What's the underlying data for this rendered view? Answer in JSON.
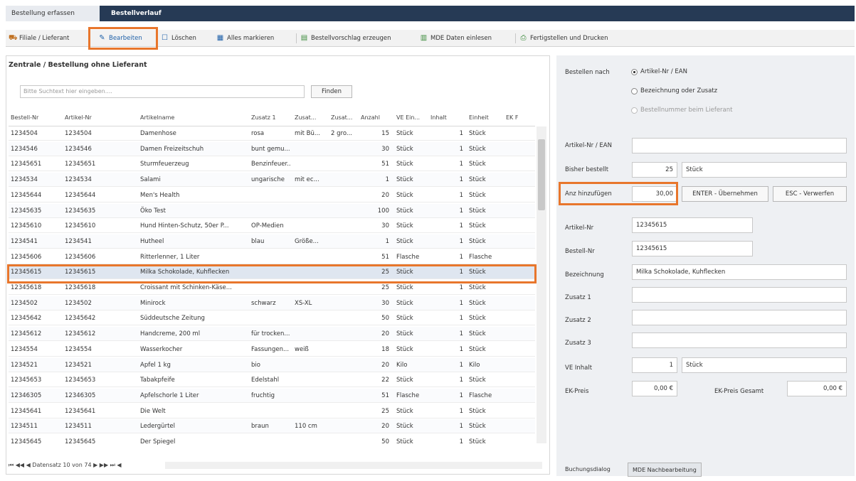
{
  "tabs": [
    "Bestellung erfassen",
    "Bestellverlauf"
  ],
  "toolbar": [
    {
      "label": "Filiale / Lieferant",
      "icon": "truck-icon"
    },
    {
      "label": "Bearbeiten",
      "icon": "edit-icon"
    },
    {
      "label": "Löschen",
      "icon": "delete-icon"
    },
    {
      "label": "Alles markieren",
      "icon": "grid-icon"
    },
    {
      "label": "Bestellvorschlag erzeugen",
      "icon": "proposal-icon"
    },
    {
      "label": "MDE Daten einlesen",
      "icon": "scanner-icon"
    },
    {
      "label": "Fertigstellen und Drucken",
      "icon": "print-icon"
    }
  ],
  "left": {
    "title": "Zentrale / Bestellung ohne Lieferant",
    "search_placeholder": "Bitte Suchtext hier eingeben....",
    "find_label": "Finden"
  },
  "grid": {
    "columns": [
      "Bestell-Nr",
      "Artikel-Nr",
      "Artikelname",
      "Zusatz 1",
      "Zusat...",
      "Zusat...",
      "Anzahl",
      "VE Ein...",
      "Inhalt",
      "Einheit",
      "EK F"
    ],
    "rows": [
      [
        "1234504",
        "1234504",
        "Damenhose",
        "rosa",
        "mit Bü...",
        "2 gro...",
        "15",
        "Stück",
        "1",
        "Stück"
      ],
      [
        "1234546",
        "1234546",
        "Damen Freizeitschuh",
        "bunt gemu...",
        "",
        "",
        "30",
        "Stück",
        "1",
        "Stück"
      ],
      [
        "12345651",
        "12345651",
        "Sturmfeuerzeug",
        "Benzinfeuer...",
        "",
        "",
        "51",
        "Stück",
        "1",
        "Stück"
      ],
      [
        "1234534",
        "1234534",
        "Salami",
        "ungarische",
        "mit ec...",
        "",
        "1",
        "Stück",
        "1",
        "Stück"
      ],
      [
        "12345644",
        "12345644",
        "Men's Health",
        "",
        "",
        "",
        "20",
        "Stück",
        "1",
        "Stück"
      ],
      [
        "12345635",
        "12345635",
        "Öko Test",
        "",
        "",
        "",
        "100",
        "Stück",
        "1",
        "Stück"
      ],
      [
        "12345610",
        "12345610",
        "Hund Hinten-Schutz, 50er P...",
        "OP-Medien",
        "",
        "",
        "30",
        "Stück",
        "1",
        "Stück"
      ],
      [
        "1234541",
        "1234541",
        "Hutheel",
        "blau",
        "Größe...",
        "",
        "1",
        "Stück",
        "1",
        "Stück"
      ],
      [
        "12345606",
        "12345606",
        "Ritterlenner, 1 Liter",
        "",
        "",
        "",
        "51",
        "Flasche",
        "1",
        "Flasche"
      ],
      [
        "12345615",
        "12345615",
        "Milka Schokolade, Kuhflecken",
        "",
        "",
        "",
        "25",
        "Stück",
        "1",
        "Stück"
      ],
      [
        "12345618",
        "12345618",
        "Croissant mit Schinken-Käse...",
        "",
        "",
        "",
        "25",
        "Stück",
        "1",
        "Stück"
      ],
      [
        "1234502",
        "1234502",
        "Minirock",
        "schwarz",
        "XS-XL",
        "",
        "30",
        "Stück",
        "1",
        "Stück"
      ],
      [
        "12345642",
        "12345642",
        "Süddeutsche Zeitung",
        "",
        "",
        "",
        "50",
        "Stück",
        "1",
        "Stück"
      ],
      [
        "12345612",
        "12345612",
        "Handcreme, 200 ml",
        "für trocken...",
        "",
        "",
        "20",
        "Stück",
        "1",
        "Stück"
      ],
      [
        "1234554",
        "1234554",
        "Wasserkocher",
        "Fassungen...",
        "weiß",
        "",
        "18",
        "Stück",
        "1",
        "Stück"
      ],
      [
        "1234521",
        "1234521",
        "Apfel 1 kg",
        "bio",
        "",
        "",
        "20",
        "Kilo",
        "1",
        "Kilo"
      ],
      [
        "12345653",
        "12345653",
        "Tabakpfeife",
        "Edelstahl",
        "",
        "",
        "22",
        "Stück",
        "1",
        "Stück"
      ],
      [
        "12346305",
        "12346305",
        "Apfelschorle 1 Liter",
        "fruchtig",
        "",
        "",
        "51",
        "Flasche",
        "1",
        "Flasche"
      ],
      [
        "12345641",
        "12345641",
        "Die Welt",
        "",
        "",
        "",
        "25",
        "Stück",
        "1",
        "Stück"
      ],
      [
        "1234511",
        "1234511",
        "Ledergürtel",
        "braun",
        "110 cm",
        "",
        "20",
        "Stück",
        "1",
        "Stück"
      ],
      [
        "12345645",
        "12345645",
        "Der Spiegel",
        "",
        "",
        "",
        "50",
        "Stück",
        "1",
        "Stück"
      ]
    ],
    "selected_index": 9,
    "nav_text": "⏮ ◀◀ ◀ Datensatz 10 von 74 ▶ ▶▶ ⏭ ◀"
  },
  "right": {
    "bestellen_nach": "Bestellen nach",
    "radio_options": [
      "Artikel-Nr / EAN",
      "Bezeichnung oder Zusatz",
      "Bestellnummer beim Lieferant"
    ],
    "artikel_ean_label": "Artikel-Nr / EAN",
    "artikel_ean_value": "",
    "bisher_label": "Bisher bestellt",
    "bisher_value": "25",
    "bisher_unit": "Stück",
    "anz_label": "Anz hinzufügen",
    "anz_value": "30,00",
    "enter_btn": "ENTER - Übernehmen",
    "esc_btn": "ESC - Verwerfen",
    "artikel_nr_label": "Artikel-Nr",
    "artikel_nr_value": "12345615",
    "bestell_nr_label": "Bestell-Nr",
    "bestell_nr_value": "12345615",
    "bezeichnung_label": "Bezeichnung",
    "bezeichnung_value": "Milka Schokolade, Kuhflecken",
    "zusatz1_label": "Zusatz 1",
    "zusatz2_label": "Zusatz 2",
    "zusatz3_label": "Zusatz 3",
    "ve_label": "VE Inhalt",
    "ve_value": "1",
    "ve_unit": "Stück",
    "ek_label": "EK-Preis",
    "ek_value": "0,00 €",
    "ek_ges_label": "EK-Preis Gesamt",
    "ek_ges_value": "0,00 €"
  },
  "bottom_tabs": [
    "Buchungsdialog",
    "MDE Nachbearbeitung"
  ],
  "highlight_color": "#e8762c"
}
